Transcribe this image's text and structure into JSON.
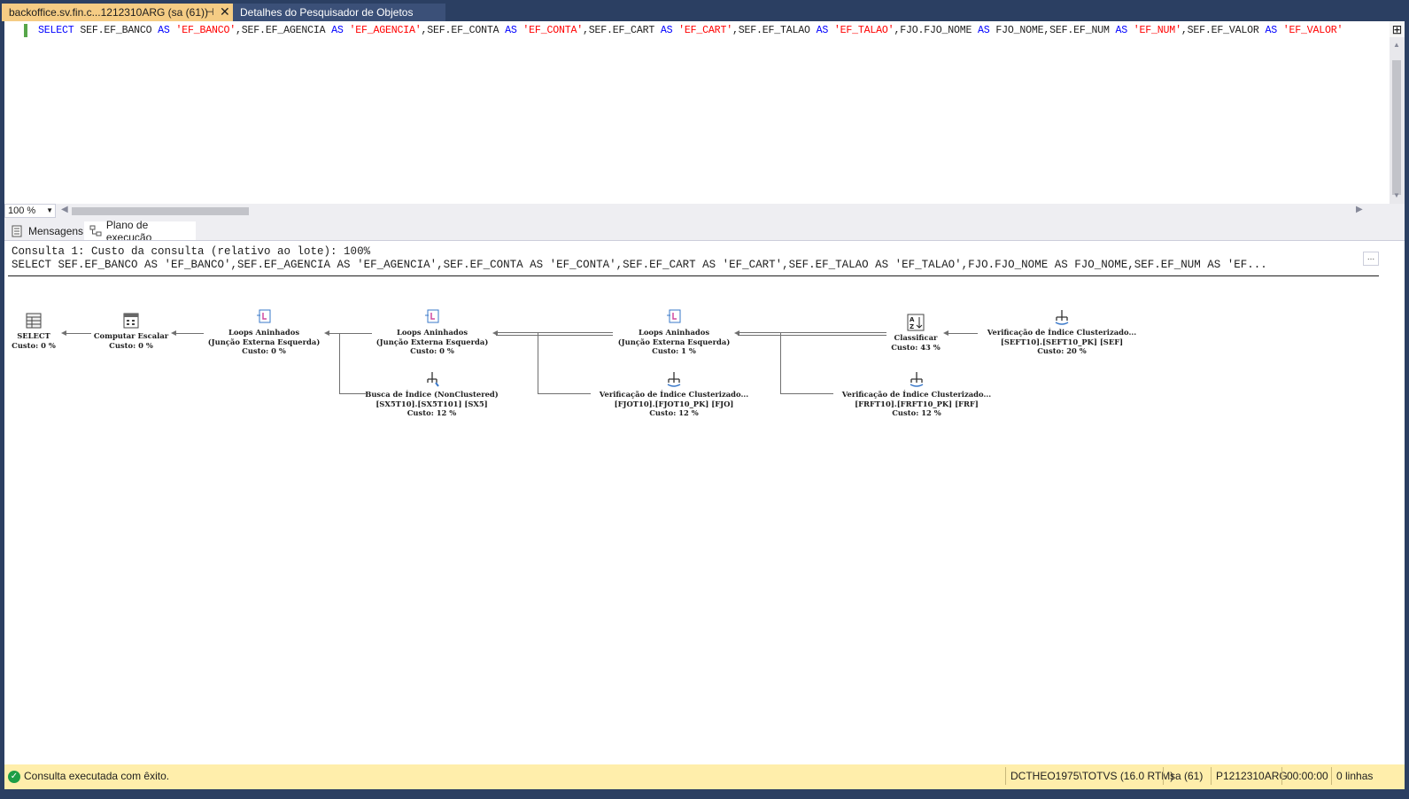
{
  "tabs": [
    {
      "label": "backoffice.sv.fin.c...1212310ARG (sa (61))",
      "active": true
    },
    {
      "label": "Detalhes do Pesquisador de Objetos",
      "active": false
    }
  ],
  "tab_pin_icon": "pin-icon",
  "tab_close_icon": "close-icon",
  "editor": {
    "sql_tokens": [
      {
        "t": "SELECT ",
        "k": "kw"
      },
      {
        "t": "SEF.EF_BANCO ",
        "k": "plain"
      },
      {
        "t": "AS ",
        "k": "kw"
      },
      {
        "t": "'EF_BANCO'",
        "k": "str"
      },
      {
        "t": ",SEF.EF_AGENCIA ",
        "k": "plain"
      },
      {
        "t": "AS ",
        "k": "kw"
      },
      {
        "t": "'EF_AGENCIA'",
        "k": "str"
      },
      {
        "t": ",SEF.EF_CONTA ",
        "k": "plain"
      },
      {
        "t": "AS ",
        "k": "kw"
      },
      {
        "t": "'EF_CONTA'",
        "k": "str"
      },
      {
        "t": ",SEF.EF_CART ",
        "k": "plain"
      },
      {
        "t": "AS ",
        "k": "kw"
      },
      {
        "t": "'EF_CART'",
        "k": "str"
      },
      {
        "t": ",SEF.EF_TALAO ",
        "k": "plain"
      },
      {
        "t": "AS ",
        "k": "kw"
      },
      {
        "t": "'EF_TALAO'",
        "k": "str"
      },
      {
        "t": ",FJO.FJO_NOME ",
        "k": "plain"
      },
      {
        "t": "AS ",
        "k": "kw"
      },
      {
        "t": "FJO_NOME,SEF.EF_NUM ",
        "k": "plain"
      },
      {
        "t": "AS ",
        "k": "kw"
      },
      {
        "t": "'EF_NUM'",
        "k": "str"
      },
      {
        "t": ",SEF.EF_VALOR ",
        "k": "plain"
      },
      {
        "t": "AS ",
        "k": "kw"
      },
      {
        "t": "'EF_VALOR'",
        "k": "str"
      }
    ],
    "zoom": "100 %"
  },
  "result_tabs": [
    {
      "label": "Mensagens",
      "icon": "messages-icon"
    },
    {
      "label": "Plano de execução",
      "icon": "execution-plan-icon"
    }
  ],
  "plan": {
    "header_line1": "Consulta 1: Custo da consulta (relativo ao lote): 100%",
    "header_line2": "SELECT SEF.EF_BANCO AS 'EF_BANCO',SEF.EF_AGENCIA AS 'EF_AGENCIA',SEF.EF_CONTA AS 'EF_CONTA',SEF.EF_CART AS 'EF_CART',SEF.EF_TALAO AS 'EF_TALAO',FJO.FJO_NOME AS FJO_NOME,SEF.EF_NUM AS 'EF...",
    "ellipsis": "...",
    "nodes": [
      {
        "id": "select",
        "lines": [
          "SELECT",
          "Custo: 0 %"
        ],
        "icon": "select-icon"
      },
      {
        "id": "compute",
        "lines": [
          "Computar Escalar",
          "Custo: 0 %"
        ],
        "icon": "compute-scalar-icon"
      },
      {
        "id": "loops1",
        "lines": [
          "Loops Aninhados",
          "(Junção Externa Esquerda)",
          "Custo: 0 %"
        ],
        "icon": "nested-loops-icon"
      },
      {
        "id": "loops2",
        "lines": [
          "Loops Aninhados",
          "(Junção Externa Esquerda)",
          "Custo: 0 %"
        ],
        "icon": "nested-loops-icon"
      },
      {
        "id": "loops3",
        "lines": [
          "Loops Aninhados",
          "(Junção Externa Esquerda)",
          "Custo: 1 %"
        ],
        "icon": "nested-loops-icon"
      },
      {
        "id": "sort",
        "lines": [
          "Classificar",
          "Custo: 43 %"
        ],
        "icon": "sort-icon"
      },
      {
        "id": "scan_sef",
        "lines": [
          "Verificação de Índice Clusterizado...",
          "[SEFT10].[SEFT10_PK] [SEF]",
          "Custo: 20 %"
        ],
        "icon": "clustered-index-scan-icon"
      },
      {
        "id": "seek_sx5",
        "lines": [
          "Busca de Índice (NonClustered)",
          "[SX5T10].[SX5T101] [SX5]",
          "Custo: 12 %"
        ],
        "icon": "index-seek-icon"
      },
      {
        "id": "scan_fjo",
        "lines": [
          "Verificação de Índice Clusterizado...",
          "[FJOT10].[FJOT10_PK] [FJO]",
          "Custo: 12 %"
        ],
        "icon": "clustered-index-scan-icon"
      },
      {
        "id": "scan_frf",
        "lines": [
          "Verificação de Índice Clusterizado...",
          "[FRFT10].[FRFT10_PK] [FRF]",
          "Custo: 12 %"
        ],
        "icon": "clustered-index-scan-icon"
      }
    ]
  },
  "status": {
    "message": "Consulta executada com êxito.",
    "server": "DCTHEO1975\\TOTVS (16.0 RTM)",
    "user": "sa (61)",
    "database": "P1212310ARG",
    "elapsed": "00:00:00",
    "rows": "0 linhas"
  }
}
